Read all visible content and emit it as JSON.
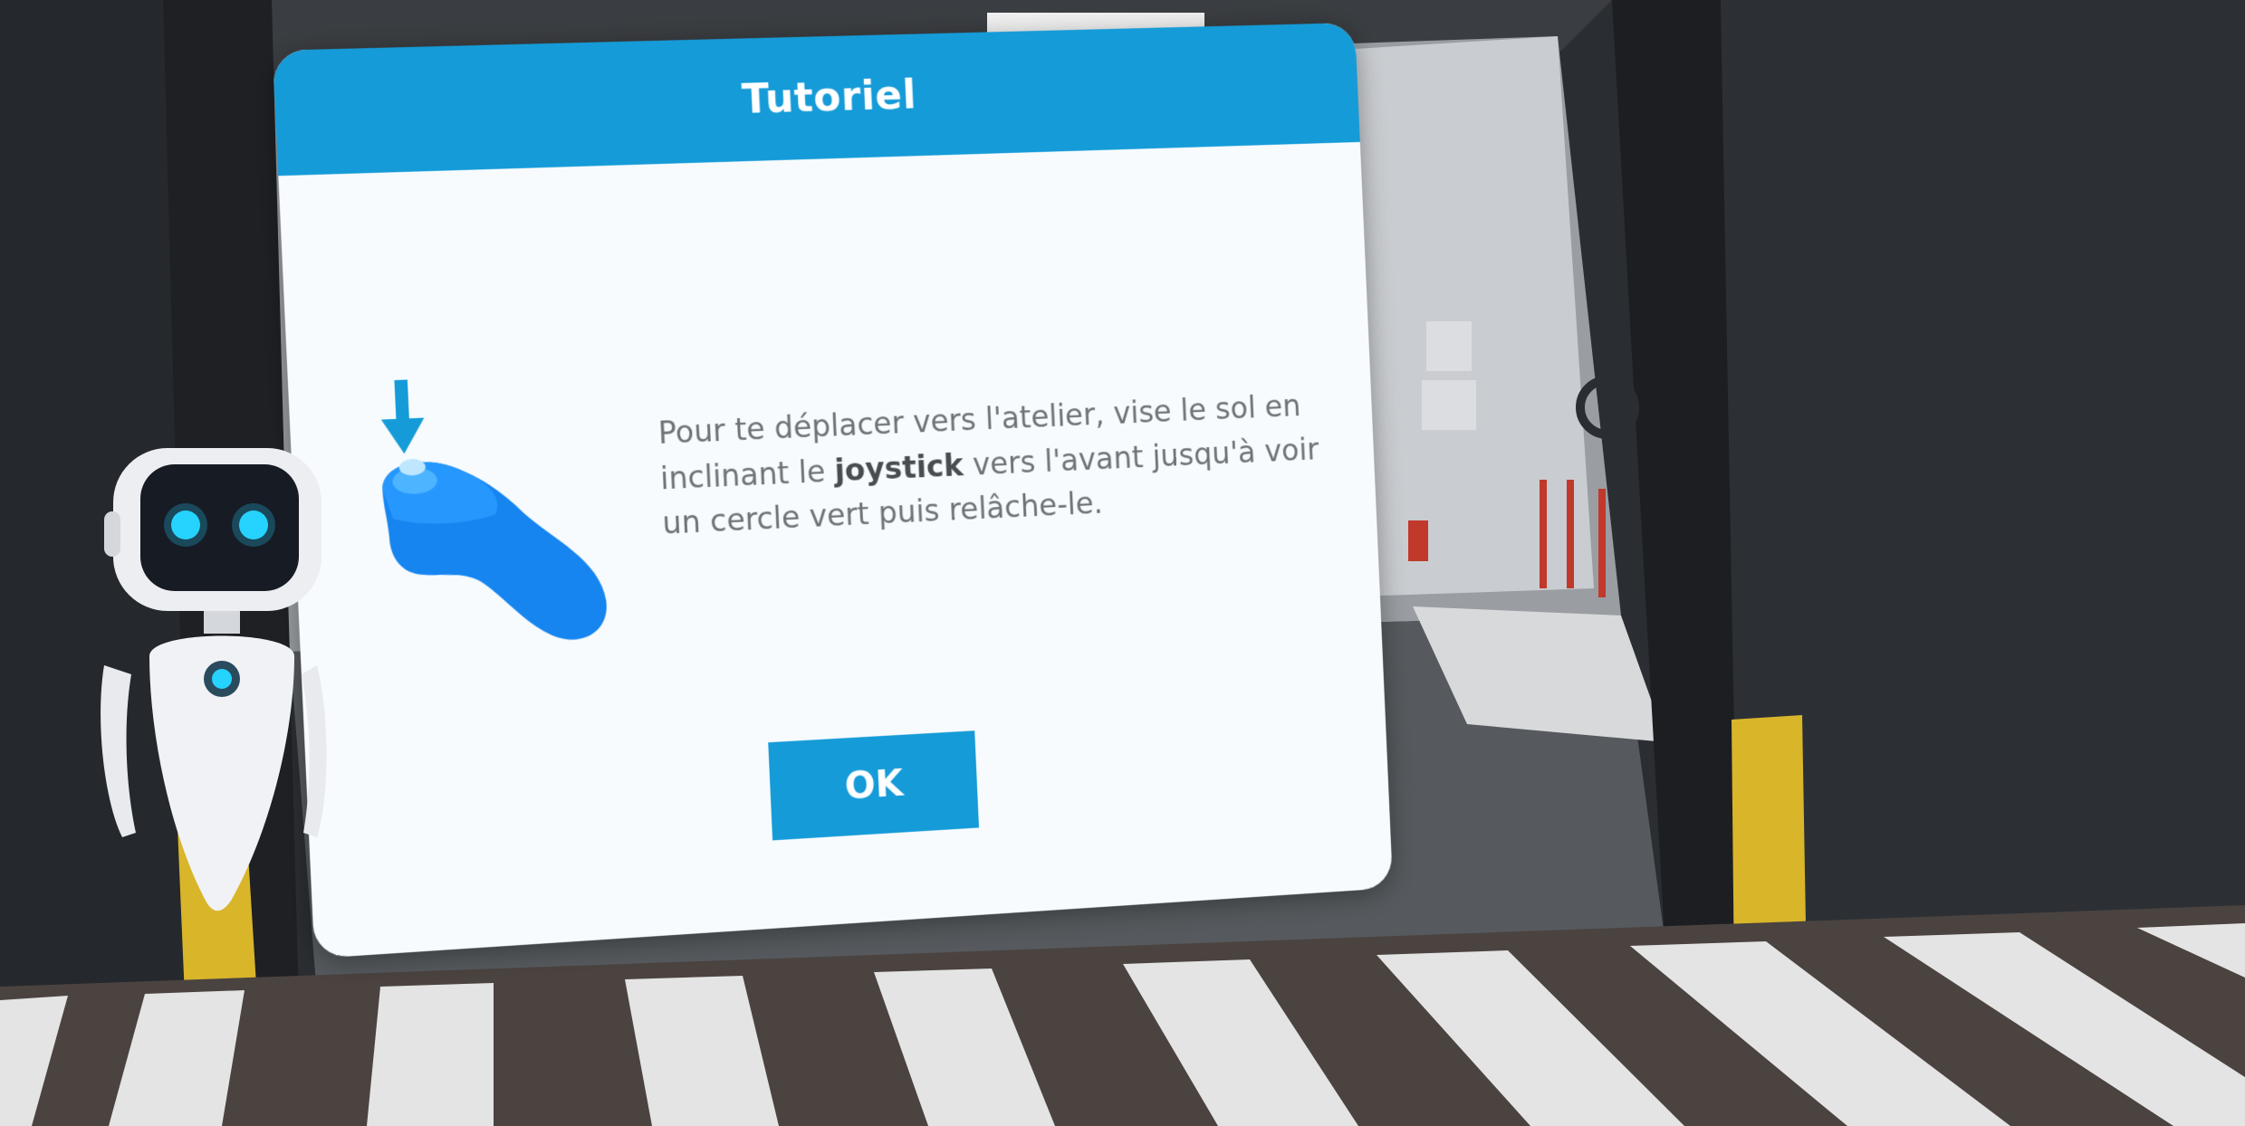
{
  "dialog": {
    "title": "Tutoriel",
    "message_before": "Pour te déplacer vers l'atelier, vise le sol en inclinant le ",
    "message_bold": "joystick",
    "message_after": " vers l'avant jusqu'à voir un cercle vert puis relâche-le.",
    "ok_label": "OK"
  },
  "icons": {
    "controller": "vr-controller-icon",
    "arrow": "arrow-down-icon",
    "robot": "robot-assistant"
  },
  "colors": {
    "accent": "#159bd8",
    "panel_background": "#f7fbfd",
    "text": "#6f7377",
    "robot_eyes": "#26d3ff",
    "safety_yellow": "#d9b52a"
  }
}
